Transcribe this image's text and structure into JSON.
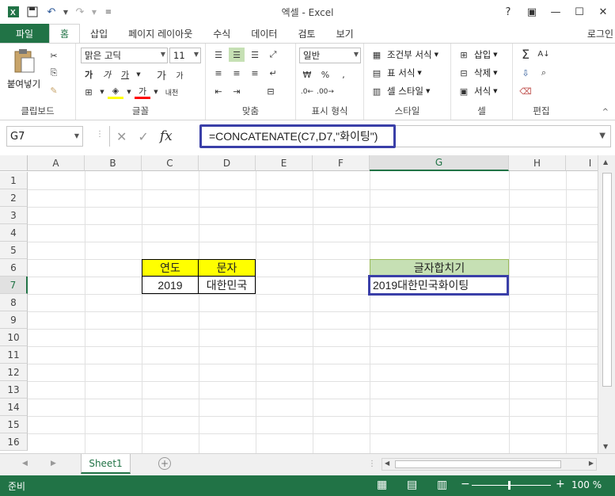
{
  "window": {
    "title": "엑셀 - Excel",
    "help": "?",
    "restore": "▣",
    "minimize": "—",
    "maximize": "☐",
    "close": "✕"
  },
  "ribbon_tabs": [
    "파일",
    "홈",
    "삽입",
    "페이지 레이아웃",
    "수식",
    "데이터",
    "검토",
    "보기"
  ],
  "login": "로그인",
  "ribbon": {
    "clipboard": {
      "paste": "붙여넣기",
      "label": "클립보드"
    },
    "font": {
      "name": "맑은 고딕",
      "size": "11",
      "label": "글꼴",
      "bold": "가",
      "italic": "가",
      "underline": "가",
      "grow": "가",
      "shrink": "가",
      "color_a": "가",
      "phonetic": "내천"
    },
    "align": {
      "label": "맞춤"
    },
    "number": {
      "format": "일반",
      "label": "표시 형식",
      "percent": "%"
    },
    "styles": {
      "cond": "조건부 서식",
      "table": "표 서식",
      "cell": "셀 스타일",
      "label": "스타일"
    },
    "cells": {
      "insert": "삽입",
      "delete": "삭제",
      "format": "서식",
      "label": "셀"
    },
    "edit": {
      "label": "편집",
      "sum": "Σ"
    }
  },
  "formula_bar": {
    "name_box": "G7",
    "formula": "=CONCATENATE(C7,D7,\"화이팅\")",
    "fx": "fx"
  },
  "columns": [
    "A",
    "B",
    "C",
    "D",
    "E",
    "F",
    "G",
    "H",
    "I"
  ],
  "rows": [
    "1",
    "2",
    "3",
    "4",
    "5",
    "6",
    "7",
    "8",
    "9",
    "10",
    "11",
    "12",
    "13",
    "14",
    "15",
    "16"
  ],
  "cells": {
    "C6": "연도",
    "D6": "문자",
    "C7": "2019",
    "D7": "대한민국",
    "G6": "글자합치기",
    "G7": "2019대한민국화이팅"
  },
  "colors": {
    "accent": "#217346",
    "highlight_yellow": "#ffff00",
    "header_green": "#c6e0b4",
    "annotation_blue": "#3a3fa8"
  },
  "sheet_tab": "Sheet1",
  "status": {
    "ready": "준비",
    "zoom": "100 %",
    "minus": "−",
    "plus": "+"
  }
}
